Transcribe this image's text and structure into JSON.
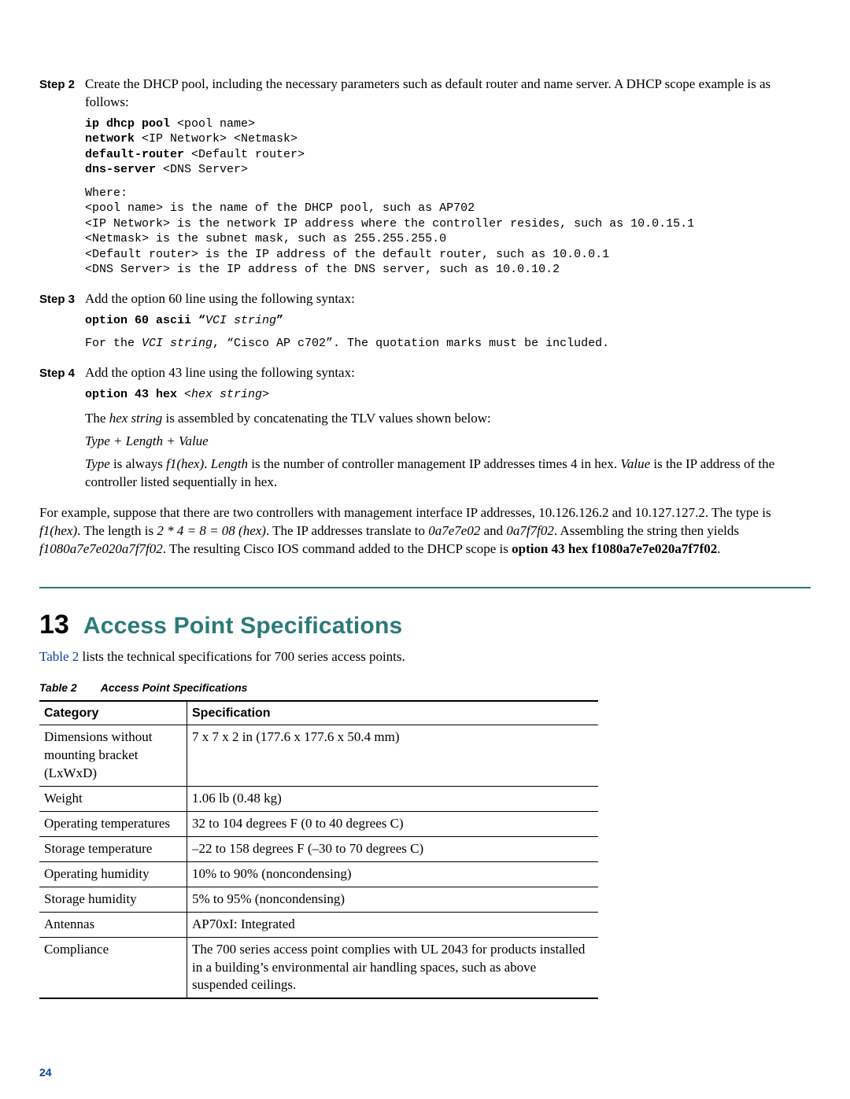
{
  "steps": {
    "step2": {
      "label": "Step 2",
      "text": "Create the DHCP pool, including the necessary parameters such as default router and name server. A DHCP scope example is as follows:",
      "code_kw1": "ip dhcp pool",
      "code_kw2": "network",
      "code_kw3": "default-router",
      "code_kw4": "dns-server",
      "code_arg1": " <pool name>",
      "code_arg2": " <IP Network> <Netmask>",
      "code_arg3": " <Default router>",
      "code_arg4": " <DNS Server>",
      "where_l0": "Where:",
      "where_l1": "<pool name> is the name of the DHCP pool, such as AP702",
      "where_l2": "<IP Network> is the network IP address where the controller resides, such as 10.0.15.1",
      "where_l3": "<Netmask> is the subnet mask, such as 255.255.255.0",
      "where_l4": "<Default router> is the IP address of the default router, such as 10.0.0.1",
      "where_l5": "<DNS Server> is the IP address of the DNS server, such as 10.0.10.2"
    },
    "step3": {
      "label": "Step 3",
      "text": "Add the option 60 line using the following syntax:",
      "code_kw": "option 60 ascii “",
      "code_it": "VCI string",
      "code_end": "”",
      "note_a": "For the ",
      "note_it": "VCI string",
      "note_b": ", “Cisco AP c702”. The quotation marks must be included."
    },
    "step4": {
      "label": "Step 4",
      "text": "Add the option 43 line using the following syntax:",
      "code_kw": "option 43 hex ",
      "code_it": "<hex string>",
      "p1a": "The ",
      "p1it": "hex string",
      "p1b": " is assembled by concatenating the TLV values shown below:",
      "p2": "Type + Length + Value",
      "p3a": "Type",
      "p3b": " is always ",
      "p3c": "f1(hex)",
      "p3d": ". ",
      "p3e": "Length",
      "p3f": " is the number of controller management IP addresses times 4 in hex. ",
      "p3g": "Value",
      "p3h": " is the IP address of the controller listed sequentially in hex."
    }
  },
  "example": {
    "a": "For example, suppose that there are two controllers with management interface IP addresses, 10.126.126.2 and 10.127.127.2. The type is ",
    "b": "f1(hex)",
    "c": ". The length is ",
    "d": "2 * 4 = 8 = 08 (hex)",
    "e": ". The IP addresses translate to ",
    "f": "0a7e7e02",
    "g": " and ",
    "h": "0a7f7f02",
    "i": ". Assembling the string then yields ",
    "j": "f1080a7e7e020a7f7f02",
    "k": ". The resulting Cisco IOS command added to the DHCP scope is ",
    "l": "option 43 hex f1080a7e7e020a7f7f02",
    "m": "."
  },
  "section": {
    "number": "13",
    "title": "Access Point Specifications",
    "intro_link": "Table 2",
    "intro_rest": " lists the technical specifications for 700 series access points."
  },
  "table": {
    "caption_a": "Table 2",
    "caption_b": "Access Point Specifications",
    "headers": {
      "cat": "Category",
      "spec": "Specification"
    },
    "rows": [
      {
        "cat": "Dimensions without mounting bracket (LxWxD)",
        "spec": "7 x 7 x 2 in (177.6 x 177.6 x 50.4 mm)"
      },
      {
        "cat": "Weight",
        "spec": "1.06 lb (0.48 kg)"
      },
      {
        "cat": "Operating temperatures",
        "spec": "32 to 104 degrees F (0 to 40 degrees C)"
      },
      {
        "cat": "Storage temperature",
        "spec": "–22 to 158 degrees F (–30 to 70 degrees C)"
      },
      {
        "cat": "Operating humidity",
        "spec": "10% to 90% (noncondensing)"
      },
      {
        "cat": "Storage humidity",
        "spec": "5% to 95% (noncondensing)"
      },
      {
        "cat": "Antennas",
        "spec": "AP70xI: Integrated"
      },
      {
        "cat": "Compliance",
        "spec": "The 700 series access point complies with UL 2043 for products installed in a building’s environmental air handling spaces, such as above suspended ceilings."
      }
    ]
  },
  "page_number": "24"
}
